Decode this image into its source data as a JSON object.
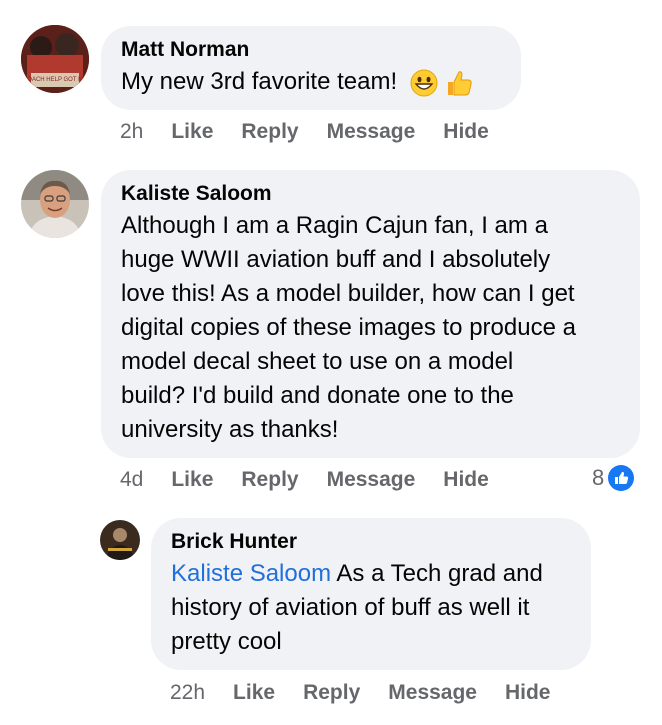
{
  "comments": [
    {
      "author": "Matt Norman",
      "text": "My new 3rd favorite team!",
      "avatar_caption": "COACH HELP GOT ME",
      "time": "2h",
      "actions": [
        "Like",
        "Reply",
        "Message",
        "Hide"
      ]
    },
    {
      "author": "Kaliste Saloom",
      "text_lines": [
        "Although I am a Ragin Cajun fan, I am a",
        "huge WWII aviation buff and I absolutely",
        "love this! As a model builder, how can I get",
        "digital copies of these images to produce a",
        "model decal sheet to use on a model",
        "build? I'd build and donate one to the",
        "university as thanks!"
      ],
      "time": "4d",
      "actions": [
        "Like",
        "Reply",
        "Message",
        "Hide"
      ],
      "reaction_count": "8"
    },
    {
      "author": "Brick Hunter",
      "mention": "Kaliste Saloom",
      "text_lines": [
        " As a Tech grad and",
        "history of aviation of buff as well it",
        "pretty cool"
      ],
      "time": "22h",
      "actions": [
        "Like",
        "Reply",
        "Message",
        "Hide"
      ]
    }
  ],
  "colors": {
    "bubble": "#f0f2f5",
    "mention": "#216fdb",
    "meta": "#65676b",
    "like_badge": "#1877f2"
  },
  "icons": [
    "grinning-face-emoji",
    "thumbs-up-emoji",
    "like-reaction-icon"
  ]
}
